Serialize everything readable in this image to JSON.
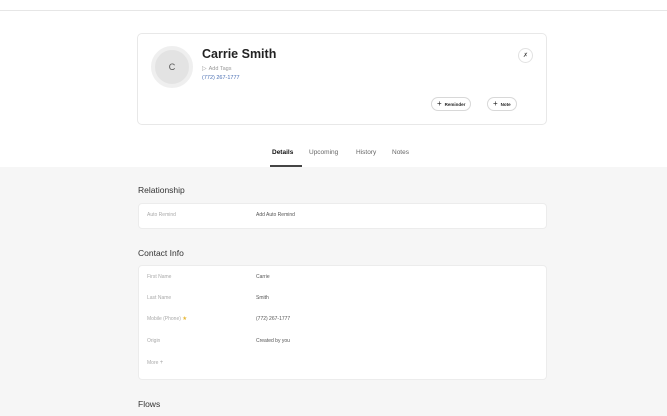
{
  "profile": {
    "avatar_initial": "C",
    "name": "Carrie Smith",
    "add_tags_label": "Add Tags",
    "phone": "(772) 267-1777",
    "corner_icon": "bell-off-icon"
  },
  "actions": {
    "reminder_label": "Reminder",
    "note_label": "Note"
  },
  "tabs": [
    {
      "label": "Details",
      "active": true
    },
    {
      "label": "Upcoming",
      "active": false
    },
    {
      "label": "History",
      "active": false
    },
    {
      "label": "Notes",
      "active": false
    }
  ],
  "relationship": {
    "heading": "Relationship",
    "rows": [
      {
        "label": "Auto Remind",
        "value": "Add Auto Remind"
      }
    ]
  },
  "contact_info": {
    "heading": "Contact Info",
    "rows": [
      {
        "label": "First Name",
        "value": "Carrie"
      },
      {
        "label": "Last Name",
        "value": "Smith"
      },
      {
        "label": "Mobile (Phone)",
        "value": "(772) 267-1777"
      },
      {
        "label": "Origin",
        "value": "Created by you"
      }
    ],
    "more_label": "More"
  },
  "flows": {
    "heading": "Flows"
  },
  "colors": {
    "link": "#4a6fb3",
    "star": "#e8b93a",
    "background_gray": "#f6f6f6"
  }
}
